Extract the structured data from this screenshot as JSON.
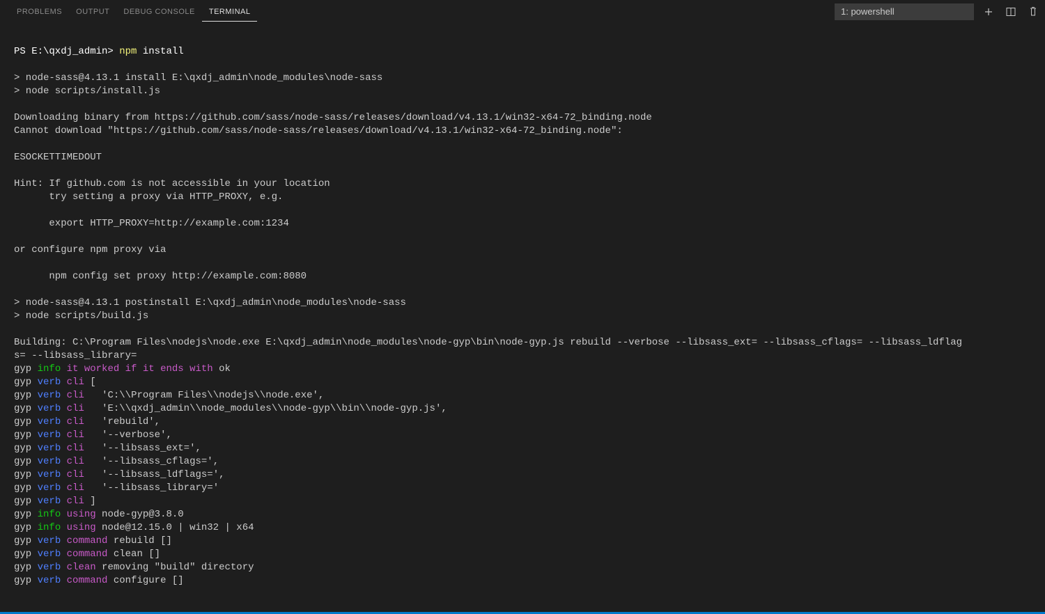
{
  "tabs": {
    "problems": "PROBLEMS",
    "output": "OUTPUT",
    "debug_console": "DEBUG CONSOLE",
    "terminal": "TERMINAL"
  },
  "dropdown": {
    "selected": "1: powershell"
  },
  "term": {
    "prompt": "PS E:\\qxdj_admin> ",
    "cmd": "npm",
    "cmd_arg": " install",
    "l3": "> node-sass@4.13.1 install E:\\qxdj_admin\\node_modules\\node-sass",
    "l4": "> node scripts/install.js",
    "l6": "Downloading binary from https://github.com/sass/node-sass/releases/download/v4.13.1/win32-x64-72_binding.node",
    "l7": "Cannot download \"https://github.com/sass/node-sass/releases/download/v4.13.1/win32-x64-72_binding.node\":",
    "l9": "ESOCKETTIMEDOUT",
    "l11": "Hint: If github.com is not accessible in your location",
    "l12": "      try setting a proxy via HTTP_PROXY, e.g.",
    "l14": "      export HTTP_PROXY=http://example.com:1234",
    "l16": "or configure npm proxy via",
    "l18": "      npm config set proxy http://example.com:8080",
    "l20": "> node-sass@4.13.1 postinstall E:\\qxdj_admin\\node_modules\\node-sass",
    "l21": "> node scripts/build.js",
    "l23a": "Building: C:\\Program Files\\nodejs\\node.exe E:\\qxdj_admin\\node_modules\\node-gyp\\bin\\node-gyp.js rebuild --verbose --libsass_ext= --libsass_cflags= --libsass_ldflag",
    "l23b": "s= --libsass_library=",
    "gyp": "gyp",
    "info": "info",
    "verb": "verb",
    "it_worked": "it worked if it ends with",
    "ok": " ok",
    "cli": "cli",
    "using": "using",
    "command": "command",
    "clean": "clean",
    "cli_open": " [",
    "cli1": "   'C:\\\\Program Files\\\\nodejs\\\\node.exe',",
    "cli2": "   'E:\\\\qxdj_admin\\\\node_modules\\\\node-gyp\\\\bin\\\\node-gyp.js',",
    "cli3": "   'rebuild',",
    "cli4": "   '--verbose',",
    "cli5": "   '--libsass_ext=',",
    "cli6": "   '--libsass_cflags=',",
    "cli7": "   '--libsass_ldflags=',",
    "cli8": "   '--libsass_library='",
    "cli_close": " ]",
    "using1": " node-gyp@3.8.0",
    "using2": " node@12.15.0 | win32 | x64",
    "cmd_rebuild": " rebuild []",
    "cmd_clean": " clean []",
    "clean_msg": " removing \"build\" directory",
    "cmd_configure": " configure []"
  }
}
